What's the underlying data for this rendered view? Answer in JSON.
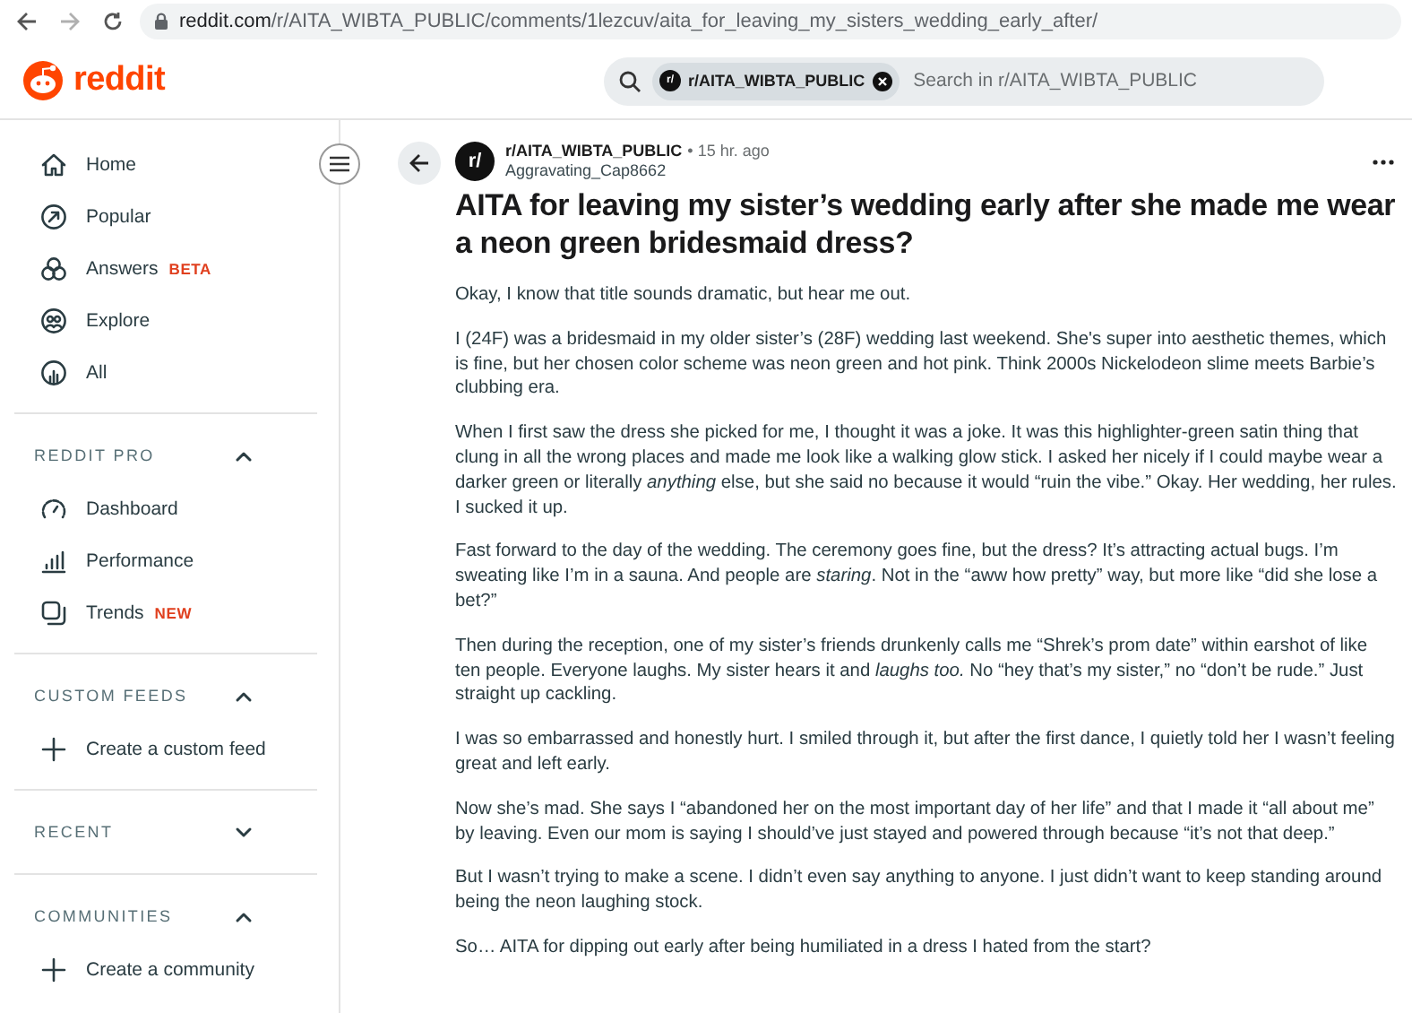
{
  "browser": {
    "url_host": "reddit.com",
    "url_path": "/r/AITA_WIBTA_PUBLIC/comments/1lezcuv/aita_for_leaving_my_sisters_wedding_early_after/",
    "forward_disabled": true
  },
  "header": {
    "logo": "reddit",
    "search": {
      "chip": "r/AITA_WIBTA_PUBLIC",
      "chip_icon": "r/",
      "placeholder": "Search in r/AITA_WIBTA_PUBLIC"
    }
  },
  "sidebar": {
    "items": [
      {
        "label": "Home",
        "kind": "home"
      },
      {
        "label": "Popular",
        "kind": "popular"
      },
      {
        "label": "Answers",
        "kind": "answers",
        "badge": "BETA"
      },
      {
        "label": "Explore",
        "kind": "explore"
      },
      {
        "label": "All",
        "kind": "all"
      }
    ],
    "sections": [
      {
        "title": "REDDIT PRO",
        "expanded": true,
        "items": [
          {
            "label": "Dashboard",
            "kind": "dashboard"
          },
          {
            "label": "Performance",
            "kind": "performance"
          },
          {
            "label": "Trends",
            "kind": "trends",
            "badge": "NEW"
          }
        ]
      },
      {
        "title": "CUSTOM FEEDS",
        "expanded": true,
        "items": [
          {
            "label": "Create a custom feed",
            "kind": "create"
          }
        ]
      },
      {
        "title": "RECENT",
        "expanded": false
      },
      {
        "title": "COMMUNITIES",
        "expanded": true,
        "items": [
          {
            "label": "Create a community",
            "kind": "create"
          }
        ]
      }
    ]
  },
  "post": {
    "subreddit": "r/AITA_WIBTA_PUBLIC",
    "avatar": "r/",
    "time": "• 15 hr. ago",
    "author": "Aggravating_Cap8662",
    "title": "AITA for leaving my sister’s wedding early after she made me wear a neon green bridesmaid dress?",
    "paragraphs": [
      "Okay, I know that title sounds dramatic, but hear me out.",
      "I (24F) was a bridesmaid in my older sister’s (28F) wedding last weekend. She's super into aesthetic themes, which is fine, but her chosen color scheme was neon green and hot pink. Think 2000s Nickelodeon slime meets Barbie’s clubbing era.",
      "When I first saw the dress she picked for me, I thought it was a joke. It was this highlighter-green satin thing that clung in all the wrong places and made me look like a walking glow stick. I asked her nicely if I could maybe wear a darker green or literally *anything* else, but she said no because it would “ruin the vibe.” Okay. Her wedding, her rules. I sucked it up.",
      "Fast forward to the day of the wedding. The ceremony goes fine, but the dress? It’s attracting actual bugs. I’m sweating like I’m in a sauna. And people are *staring*. Not in the “aww how pretty” way, but more like “did she lose a bet?”",
      "Then during the reception, one of my sister’s friends drunkenly calls me “Shrek’s prom date” within earshot of like ten people. Everyone laughs. My sister hears it and *laughs too.* No “hey that’s my sister,” no “don’t be rude.” Just straight up cackling.",
      "I was so embarrassed and honestly hurt. I smiled through it, but after the first dance, I quietly told her I wasn’t feeling great and left early.",
      "Now she’s mad. She says I “abandoned her on the most important day of her life” and that I made it “all about me” by leaving. Even our mom is saying I should’ve just stayed and powered through because “it’s not that deep.”",
      "But I wasn’t trying to make a scene. I didn’t even say anything to anyone. I just didn’t want to keep standing around being the neon laughing stock.",
      "So… AITA for dipping out early after being humiliated in a dress I hated from the start?"
    ]
  }
}
